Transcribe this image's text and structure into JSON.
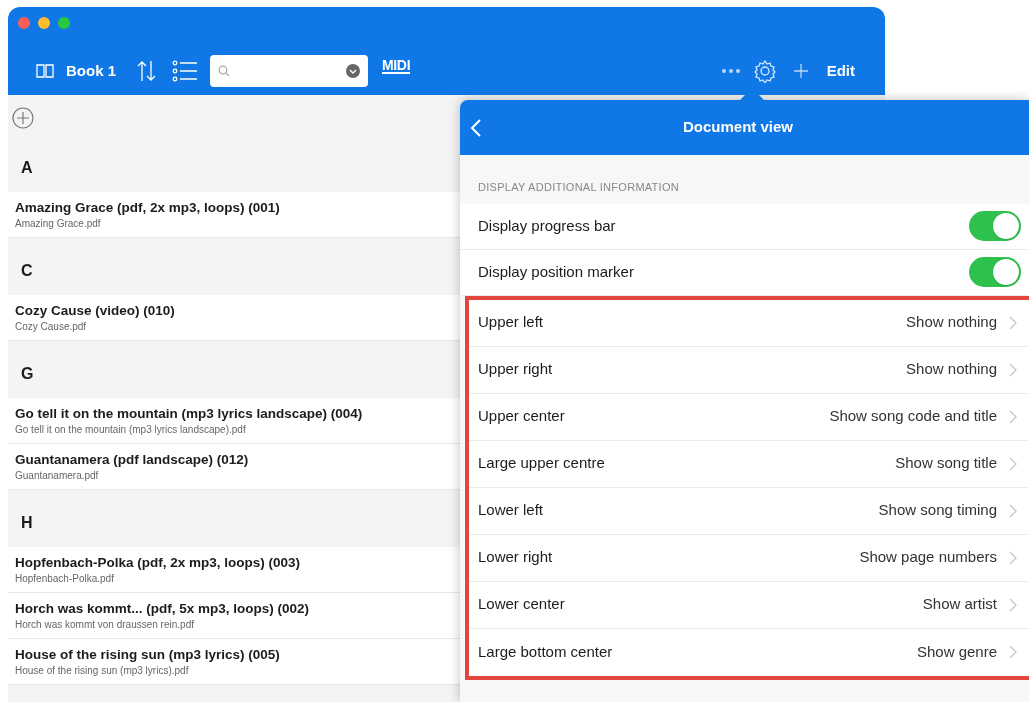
{
  "toolbar": {
    "book": "Book 1",
    "logo": "MIDI",
    "edit": "Edit"
  },
  "songs": [
    {
      "letter": "A",
      "items": [
        {
          "title": "Amazing Grace (pdf, 2x mp3, loops) (001)",
          "file": "Amazing Grace.pdf"
        }
      ]
    },
    {
      "letter": "C",
      "items": [
        {
          "title": "Cozy Cause (video) (010)",
          "file": "Cozy Cause.pdf"
        }
      ]
    },
    {
      "letter": "G",
      "items": [
        {
          "title": "Go tell it on the mountain (mp3 lyrics landscape) (004)",
          "file": "Go tell it on the mountain (mp3 lyrics landscape).pdf"
        },
        {
          "title": "Guantanamera (pdf landscape) (012)",
          "file": "Guantanamera.pdf"
        }
      ]
    },
    {
      "letter": "H",
      "items": [
        {
          "title": "Hopfenbach-Polka (pdf, 2x mp3, loops) (003)",
          "file": "Hopfenbach-Polka.pdf"
        },
        {
          "title": "Horch was kommt... (pdf, 5x mp3, loops) (002)",
          "file": "Horch was kommt von draussen rein.pdf"
        },
        {
          "title": "House of the rising sun (mp3 lyrics) (005)",
          "file": "House of the rising sun (mp3 lyrics).pdf"
        }
      ]
    }
  ],
  "popover": {
    "title": "Document view",
    "section": "DISPLAY ADDITIONAL INFORMATION",
    "toggles": [
      {
        "label": "Display progress bar",
        "on": true
      },
      {
        "label": "Display position marker",
        "on": true
      }
    ],
    "options": [
      {
        "label": "Upper left",
        "value": "Show nothing"
      },
      {
        "label": "Upper right",
        "value": "Show nothing"
      },
      {
        "label": "Upper center",
        "value": "Show song code and title"
      },
      {
        "label": "Large upper centre",
        "value": "Show song title"
      },
      {
        "label": "Lower left",
        "value": "Show song timing"
      },
      {
        "label": "Lower right",
        "value": "Show page numbers"
      },
      {
        "label": "Lower center",
        "value": "Show artist"
      },
      {
        "label": "Large bottom center",
        "value": "Show genre"
      }
    ]
  }
}
